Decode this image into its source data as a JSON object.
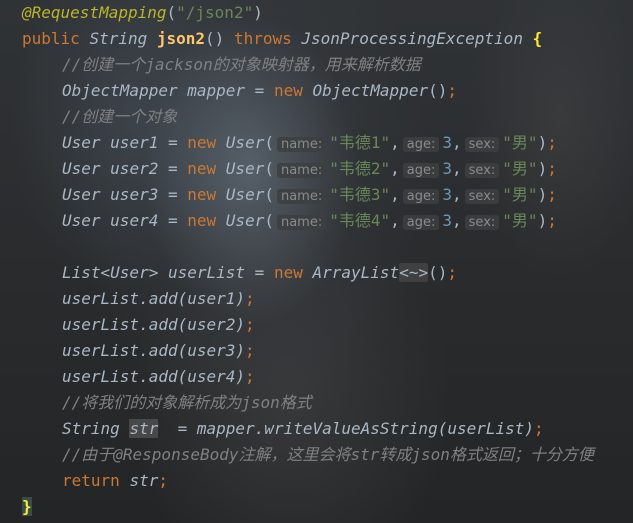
{
  "code": {
    "annotation": "@RequestMapping",
    "annotation_arg": "\"/json2\"",
    "kw_public": "public",
    "ret_type": "String",
    "method_name": "json2",
    "kw_throws": "throws",
    "exception": "JsonProcessingException",
    "comment1": "//创建一个jackson的对象映射器，用来解析数据",
    "mapper_type": "ObjectMapper",
    "mapper_var": "mapper",
    "kw_new": "new",
    "comment2": "//创建一个对象",
    "user_type": "User",
    "hint_name": "name:",
    "hint_age": "age:",
    "hint_sex": "sex:",
    "users": [
      {
        "var": "user1",
        "name": "\"韦德1\"",
        "age": "3",
        "sex": "\"男\""
      },
      {
        "var": "user2",
        "name": "\"韦德2\"",
        "age": "3",
        "sex": "\"男\""
      },
      {
        "var": "user3",
        "name": "\"韦德3\"",
        "age": "3",
        "sex": "\"男\""
      },
      {
        "var": "user4",
        "name": "\"韦德4\"",
        "age": "3",
        "sex": "\"男\""
      }
    ],
    "list_type": "List<User>",
    "list_var": "userList",
    "array_list": "ArrayList",
    "diamond": "<~>",
    "add_calls": [
      "userList.add(user1)",
      "userList.add(user2)",
      "userList.add(user3)",
      "userList.add(user4)"
    ],
    "comment3": "//将我们的对象解析成为json格式",
    "str_var": "str",
    "write_call": "mapper.writeValueAsString(userList)",
    "comment4": "//由于@ResponseBody注解，这里会将str转成json格式返回；十分方便",
    "kw_return": "return",
    "brace_open": "{",
    "brace_close": "}"
  },
  "colors": {
    "annotation": "#bbb529",
    "keyword": "#cc7832",
    "string": "#6a8759",
    "number": "#6897bb",
    "comment": "#808080",
    "method": "#ffc66d",
    "text": "#a9b7c6"
  }
}
